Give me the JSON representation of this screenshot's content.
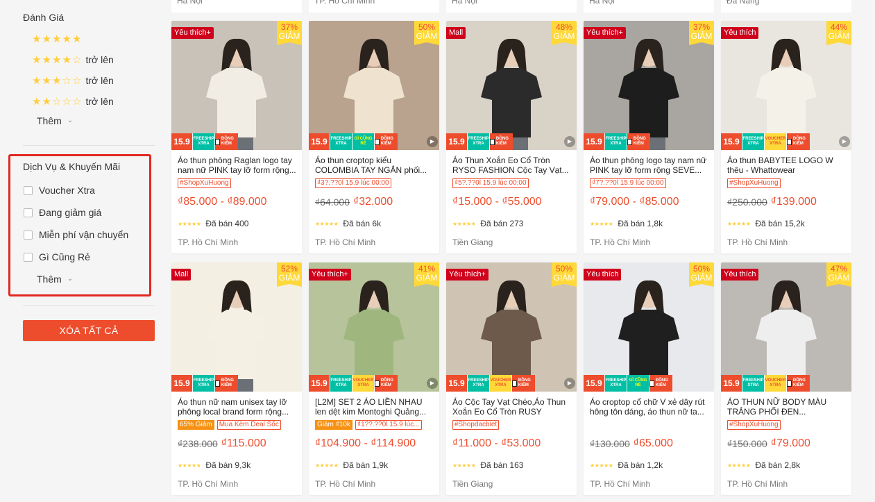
{
  "sidebar": {
    "rating_title": "Đánh Giá",
    "rating_rows": [
      {
        "full": 5,
        "suffix": ""
      },
      {
        "full": 4,
        "suffix": "trở lên"
      },
      {
        "full": 3,
        "suffix": "trở lên"
      },
      {
        "full": 2,
        "suffix": "trở lên"
      }
    ],
    "rating_more": "Thêm",
    "services_title": "Dịch Vụ & Khuyến Mãi",
    "services": [
      "Voucher Xtra",
      "Đang giảm giá",
      "Miễn phí vận chuyển",
      "Gì Cũng Rẻ"
    ],
    "services_more": "Thêm",
    "clear_all": "XÓA TẤT CẢ"
  },
  "top_strip": [
    "Hà Nội",
    "TP. Hồ Chí Minh",
    "Hà Nội",
    "Hà Nội",
    "Đà Nẵng"
  ],
  "common": {
    "badge_price": "15.9",
    "freeship": "FREESHIP XTRA",
    "gicungre": "GÌ CŨNG RẺ",
    "voucher": "VOUCHER XTRA",
    "dongkiem": "ĐỒNG KIỂM",
    "discount_word": "GIẢM"
  },
  "products": [
    {
      "tag": "Yêu thích+",
      "discount": "37%",
      "name": "Áo thun phông Raglan logo tay nam nữ PINK tay lỡ form rộng...",
      "labels": [
        {
          "text": "#ShopXuHuong",
          "style": "o"
        }
      ],
      "old_price": "",
      "price": "₫85.000 - ₫89.000",
      "sold": "Đã bán 400",
      "location": "TP. Hồ Chí Minh",
      "badges": [
        "fs",
        "dk"
      ],
      "img": "#c9c2b8"
    },
    {
      "tag": "",
      "discount": "50%",
      "name": "Áo thun croptop kiểu COLOMBIA TAY NGẮN phối...",
      "labels": [
        {
          "text": "₫3?.??0l 15.9 lúc 00:00",
          "style": "o"
        }
      ],
      "old_price": "₫64.000",
      "price": "₫32.000",
      "sold": "Đã bán 6k",
      "location": "TP. Hồ Chí Minh",
      "badges": [
        "fs",
        "gcr",
        "dk"
      ],
      "img": "#b9a28e"
    },
    {
      "tag": "Mall",
      "discount": "48%",
      "name": "Áo Thun Xoắn Eo Cổ Tròn RYSO FASHION Cộc Tay Vạt...",
      "labels": [
        {
          "text": "₫5?.??0l 15.9 lúc 00:00",
          "style": "o"
        }
      ],
      "old_price": "",
      "price": "₫15.000 - ₫55.000",
      "sold": "Đã bán 273",
      "location": "Tiền Giang",
      "badges": [
        "fs",
        "dk"
      ],
      "img": "#d8d2c7"
    },
    {
      "tag": "Yêu thích+",
      "discount": "37%",
      "name": "Áo thun phông logo tay nam nữ PINK tay lỡ form rộng SEVE...",
      "labels": [
        {
          "text": "₫7?.??0l 15.9 lúc 00:00",
          "style": "o"
        }
      ],
      "old_price": "",
      "price": "₫79.000 - ₫85.000",
      "sold": "Đã bán 1,8k",
      "location": "TP. Hồ Chí Minh",
      "badges": [
        "fs",
        "dk"
      ],
      "img": "#a9a6a2"
    },
    {
      "tag": "Yêu thích",
      "discount": "44%",
      "name": "Áo thun BABYTEE LOGO W thêu - Whattowear",
      "labels": [
        {
          "text": "#ShopXuHuong",
          "style": "o"
        }
      ],
      "old_price": "₫250.000",
      "price": "₫139.000",
      "sold": "Đã bán 15,2k",
      "location": "TP. Hồ Chí Minh",
      "badges": [
        "fs",
        "vx",
        "dk"
      ],
      "img": "#e9e6df"
    },
    {
      "tag": "Mall",
      "discount": "52%",
      "name": "Áo thun nữ nam unisex tay lỡ phông local brand form rộng...",
      "labels": [
        {
          "text": "65% Giảm",
          "style": "f"
        },
        {
          "text": "Mua Kèm Deal Sốc",
          "style": "o"
        }
      ],
      "old_price": "₫238.000",
      "price": "₫115.000",
      "sold": "Đã bán 9,3k",
      "location": "TP. Hồ Chí Minh",
      "badges": [
        "fs",
        "dk"
      ],
      "img": "#f3efe2"
    },
    {
      "tag": "Yêu thích+",
      "discount": "41%",
      "name": "[L2M] SET 2 ÁO LIỀN NHAU len dệt kim Montoghi Quảng...",
      "labels": [
        {
          "text": "Giảm ₫10k",
          "style": "f"
        },
        {
          "text": "₫1??.??0l 15.9 lúc...",
          "style": "o"
        }
      ],
      "old_price": "",
      "price": "₫104.900 - ₫114.900",
      "sold": "Đã bán 1,9k",
      "location": "TP. Hồ Chí Minh",
      "badges": [
        "fs",
        "vx",
        "dk"
      ],
      "img": "#b7c39a"
    },
    {
      "tag": "Yêu thích+",
      "discount": "50%",
      "name": "Áo Cộc Tay Vạt Chéo,Áo Thun Xoắn Eo Cổ Tròn RUSY",
      "labels": [
        {
          "text": "#Shopdacbiet",
          "style": "o"
        }
      ],
      "old_price": "",
      "price": "₫11.000 - ₫53.000",
      "sold": "Đã bán 163",
      "location": "Tiền Giang",
      "badges": [
        "fs",
        "vx",
        "dk"
      ],
      "img": "#cfc4b4"
    },
    {
      "tag": "Yêu thích",
      "discount": "50%",
      "name": "Áo croptop cổ chữ V xẻ dây rút hông tôn dáng, áo thun nữ ta...",
      "labels": [],
      "old_price": "₫130.000",
      "price": "₫65.000",
      "sold": "Đã bán 1,2k",
      "location": "TP. Hồ Chí Minh",
      "badges": [
        "fs",
        "gcr",
        "dk"
      ],
      "img": "#e7e9ec"
    },
    {
      "tag": "Yêu thích",
      "discount": "47%",
      "name": "ÁO THUN NỮ BODY MÀU TRẮNG PHỐI ĐEN...",
      "labels": [
        {
          "text": "#ShopXuHuong",
          "style": "o"
        }
      ],
      "old_price": "₫150.000",
      "price": "₫79.000",
      "sold": "Đã bán 2,8k",
      "location": "TP. Hồ Chí Minh",
      "badges": [
        "fs",
        "vx",
        "dk"
      ],
      "img": "#bdbab6"
    }
  ]
}
